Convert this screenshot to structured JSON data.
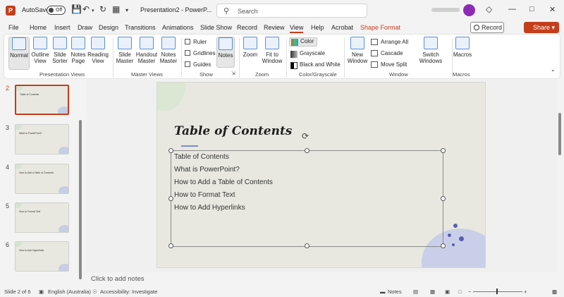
{
  "titlebar": {
    "app_logo": "P",
    "autosave_label": "AutoSave",
    "autosave_state": "Off",
    "doc_title": "Presentation2 - PowerP...",
    "search_placeholder": "Search",
    "icons": [
      "save-icon",
      "undo-icon",
      "redo-icon",
      "customize-icon"
    ]
  },
  "tabs": [
    "File",
    "Home",
    "Insert",
    "Draw",
    "Design",
    "Transitions",
    "Animations",
    "Slide Show",
    "Record",
    "Review",
    "View",
    "Help",
    "Acrobat",
    "Shape Format"
  ],
  "active_tab": "View",
  "record_label": "Record",
  "share_label": "Share",
  "ribbon": {
    "presentation_views": {
      "label": "Presentation Views",
      "buttons": [
        "Normal",
        "Outline View",
        "Slide Sorter",
        "Notes Page",
        "Reading View"
      ]
    },
    "master_views": {
      "label": "Master Views",
      "buttons": [
        "Slide Master",
        "Handout Master",
        "Notes Master"
      ]
    },
    "show": {
      "label": "Show",
      "checks": [
        "Ruler",
        "Gridlines",
        "Guides"
      ],
      "notes": "Notes"
    },
    "zoom": {
      "label": "Zoom",
      "buttons": [
        "Zoom",
        "Fit to Window"
      ]
    },
    "color_grayscale": {
      "label": "Color/Grayscale",
      "options": [
        "Color",
        "Grayscale",
        "Black and White"
      ]
    },
    "window": {
      "label": "Window",
      "new_window": "New Window",
      "small": [
        "Arrange All",
        "Cascade",
        "Move Split"
      ],
      "switch": "Switch Windows"
    },
    "macros": {
      "label": "Macros",
      "button": "Macros"
    }
  },
  "thumbnails": [
    {
      "num": "2",
      "title": "Table of Contents"
    },
    {
      "num": "3",
      "title": "What is PowerPoint?"
    },
    {
      "num": "4",
      "title": "How to Add a Table of Contents"
    },
    {
      "num": "5",
      "title": "How to Format Text"
    },
    {
      "num": "6",
      "title": "How to Add Hyperlinks"
    }
  ],
  "slide": {
    "title": "Table of Contents",
    "lines": [
      "Table of Contents",
      "What is PowerPoint?",
      "How to Add a Table of Contents",
      "How to Format Text",
      "How to Add Hyperlinks"
    ]
  },
  "notes_placeholder": "Click to add notes",
  "status": {
    "slide_count": "Slide 2 of 6",
    "language": "English (Australia)",
    "accessibility": "Accessibility: Investigate",
    "notes": "Notes"
  },
  "colors": {
    "accent": "#c43e1c",
    "avatar": "#8e2bb5"
  }
}
